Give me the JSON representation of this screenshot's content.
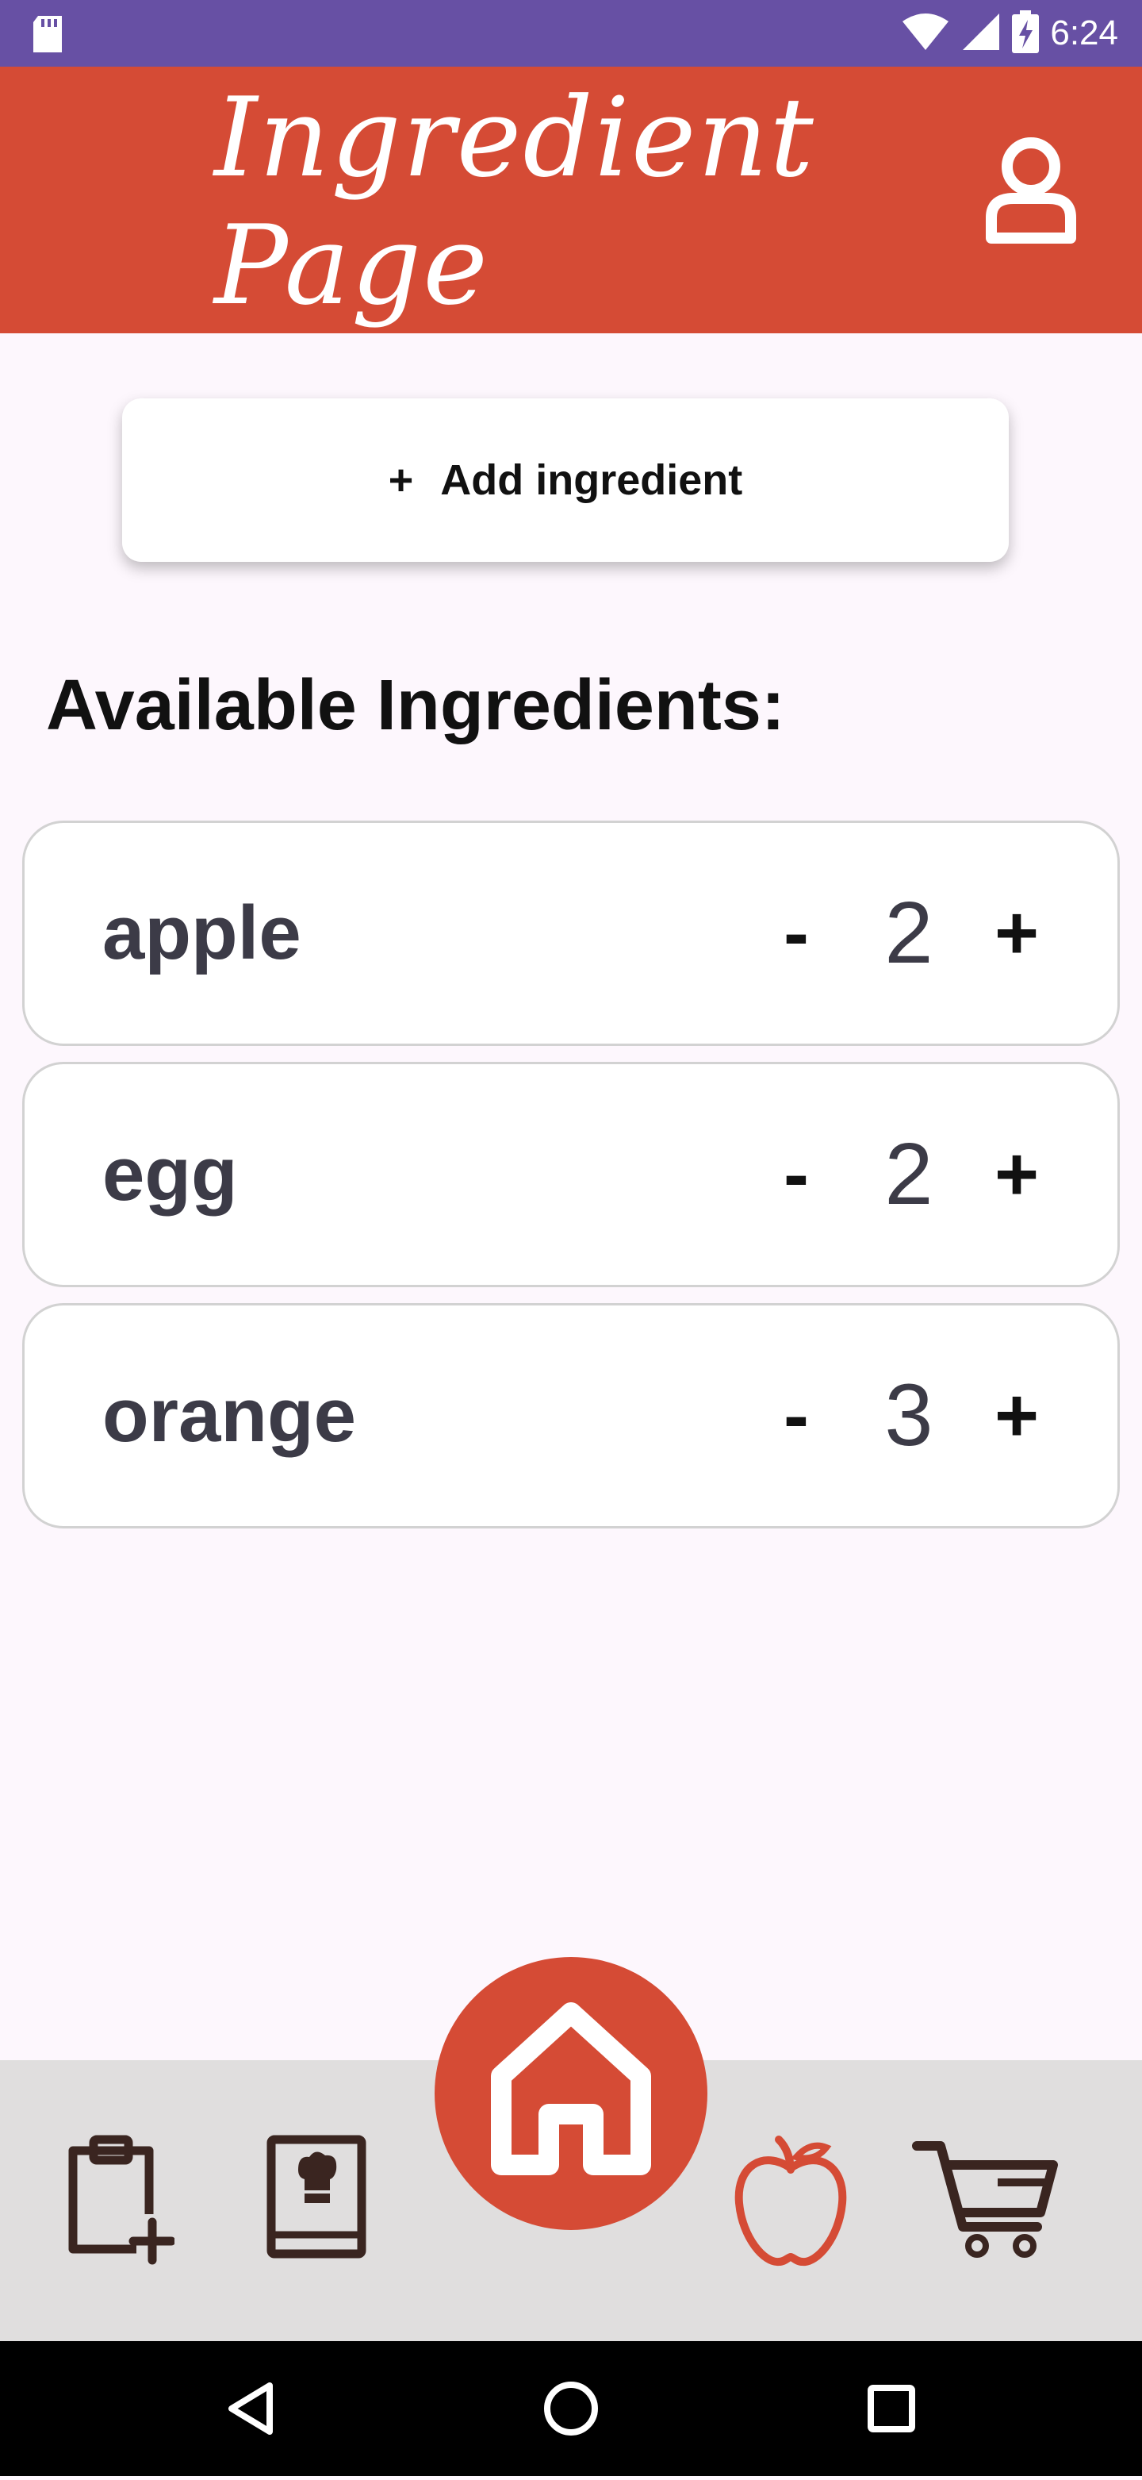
{
  "status_bar": {
    "time": "6:24",
    "icons": [
      "sd-card-icon",
      "wifi-icon",
      "signal-icon",
      "battery-charging-icon"
    ]
  },
  "header": {
    "title": "Ingredient Page",
    "profile_icon": "user-icon"
  },
  "add_button": {
    "plus": "+",
    "label": "Add ingredient"
  },
  "section_title": "Available Ingredients:",
  "ingredients": [
    {
      "name": "apple",
      "minus": "-",
      "qty": "2",
      "plus": "+"
    },
    {
      "name": "egg",
      "minus": "-",
      "qty": "2",
      "plus": "+"
    },
    {
      "name": "orange",
      "minus": "-",
      "qty": "3",
      "plus": "+"
    }
  ],
  "bottom_nav": {
    "items": [
      {
        "icon": "clipboard-add-icon"
      },
      {
        "icon": "recipe-book-icon"
      },
      {
        "icon": "home-icon"
      },
      {
        "icon": "apple-icon",
        "active": true
      },
      {
        "icon": "cart-icon"
      }
    ]
  },
  "colors": {
    "status_bar": "#6750a4",
    "header": "#d54b35",
    "accent": "#d54b35",
    "background": "#fdf7fd",
    "nav_bg": "#e0dede",
    "icon_dark": "#3a2520"
  }
}
